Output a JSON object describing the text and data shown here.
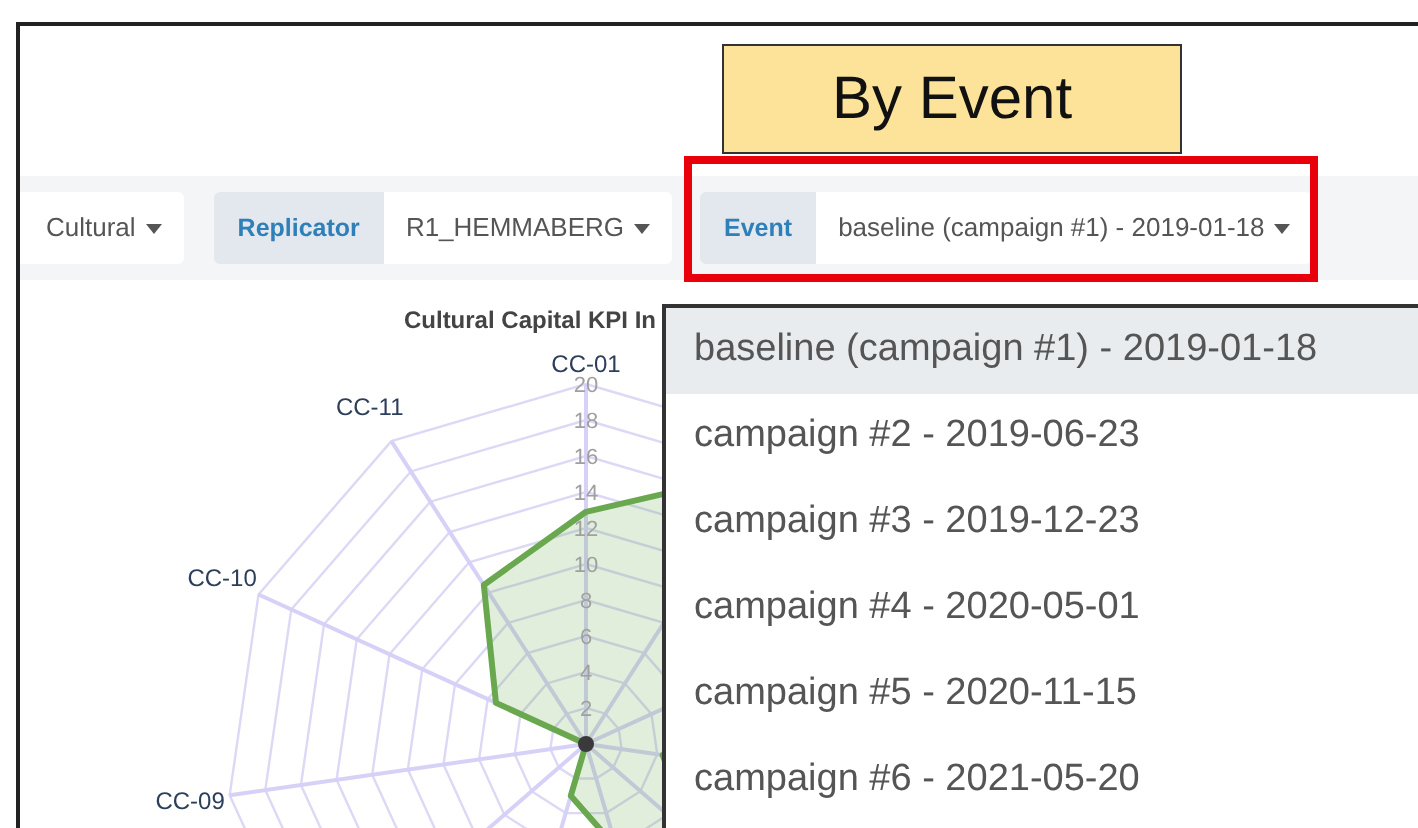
{
  "callout": {
    "text": "By Event"
  },
  "filters": [
    {
      "kind": "select",
      "value": "Cultural",
      "highlighted": false
    },
    {
      "kind": "group",
      "label": "Replicator",
      "value": "R1_HEMMABERG",
      "highlighted": false
    },
    {
      "kind": "group",
      "label": "Event",
      "value": "baseline (campaign #1) - 2019-01-18",
      "highlighted": true
    }
  ],
  "chart": {
    "title": "Cultural Capital KPI In",
    "axes": [
      "CC-01",
      "CC-11",
      "CC-10",
      "CC-09"
    ],
    "ticks": [
      "20",
      "18",
      "16",
      "14",
      "12",
      "10",
      "8",
      "6",
      "4",
      "2"
    ]
  },
  "event_menu": {
    "items": [
      {
        "label": "baseline (campaign #1) - 2019-01-18",
        "selected": true
      },
      {
        "label": "campaign #2 - 2019-06-23",
        "selected": false
      },
      {
        "label": "campaign #3 - 2019-12-23",
        "selected": false
      },
      {
        "label": "campaign #4 - 2020-05-01",
        "selected": false
      },
      {
        "label": "campaign #5 - 2020-11-15",
        "selected": false
      },
      {
        "label": "campaign #6 - 2021-05-20",
        "selected": false
      }
    ]
  }
}
